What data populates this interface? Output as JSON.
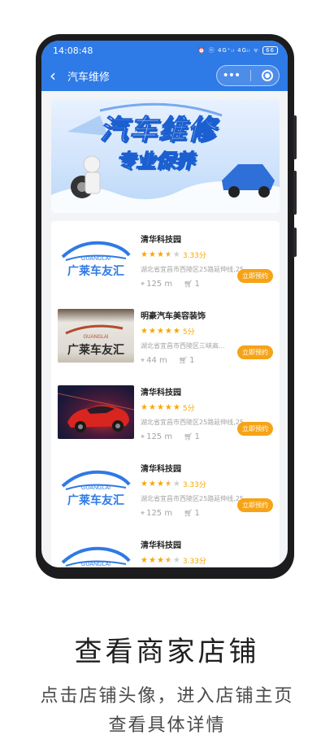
{
  "status_bar": {
    "time": "14:08:48",
    "icons": "⏰ ⓝ 4G⁺ᵢₗ 4Gᵢₗ ᯤ",
    "battery": "66"
  },
  "nav": {
    "title": "汽车维修"
  },
  "banner": {
    "title": "汽车维修",
    "subtitle": "专业保养"
  },
  "shops": [
    {
      "name": "清华科技园",
      "rating_stars": 3.5,
      "score": "3.33分",
      "address": "湖北省宜昌市西陵区25路延伸线,25...",
      "distance": "125 m",
      "cart": "1",
      "button": "立即预约",
      "image": "logo"
    },
    {
      "name": "明豪汽车美容装饰",
      "rating_stars": 5,
      "score": "5分",
      "address": "湖北省宜昌市西陵区三峡高...",
      "distance": "44 m",
      "cart": "1",
      "button": "立即预约",
      "image": "wall"
    },
    {
      "name": "清华科技园",
      "rating_stars": 5,
      "score": "5分",
      "address": "湖北省宜昌市西陵区25路延伸线,25...",
      "distance": "125 m",
      "cart": "1",
      "button": "立即预约",
      "image": "car"
    },
    {
      "name": "清华科技园",
      "rating_stars": 3.5,
      "score": "3.33分",
      "address": "湖北省宜昌市西陵区25路延伸线,25...",
      "distance": "125 m",
      "cart": "1",
      "button": "立即预约",
      "image": "logo"
    },
    {
      "name": "清华科技园",
      "rating_stars": 3.5,
      "score": "3.33分",
      "address": "",
      "distance": "",
      "cart": "",
      "button": "",
      "image": "logo"
    }
  ],
  "logo_text": {
    "latin": "GUANGLAI",
    "chinese": "广莱车友汇"
  },
  "caption": {
    "title": "查看商家店铺",
    "line1": "点击店铺头像，进入店铺主页",
    "line2": "查看具体详情"
  },
  "colors": {
    "primary": "#2e7ae6",
    "accent": "#f6a316",
    "star": "#f7a600"
  }
}
